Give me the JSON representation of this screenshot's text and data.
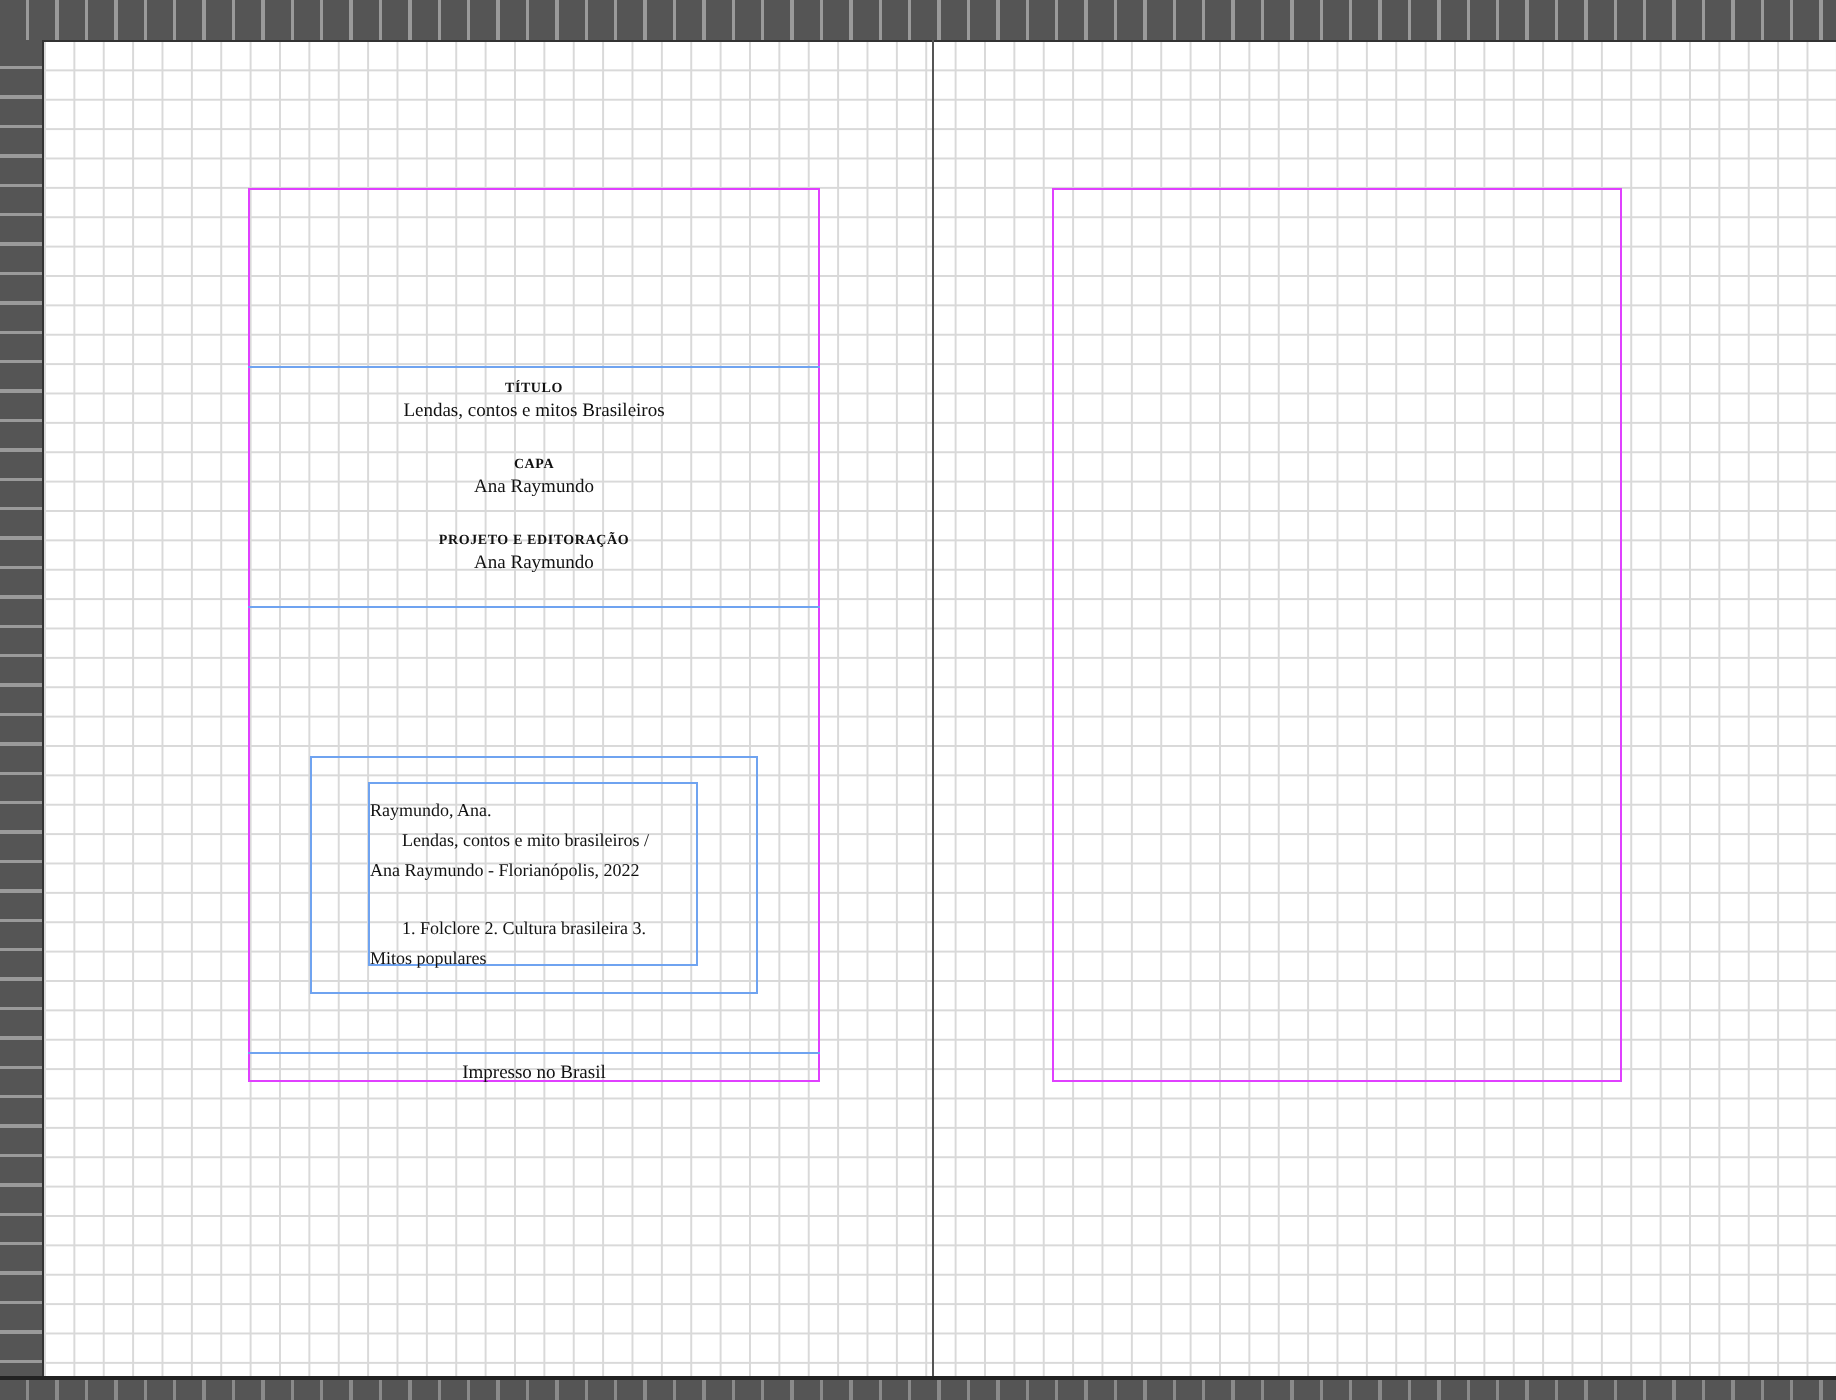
{
  "left_page": {
    "credits": [
      {
        "label": "TÍTULO",
        "value": "Lendas, contos e mitos Brasileiros"
      },
      {
        "label": "CAPA",
        "value": "Ana Raymundo"
      },
      {
        "label": "PROJETO E EDITORAÇÃO",
        "value": "Ana Raymundo"
      }
    ],
    "catalog_card": {
      "lines": [
        {
          "text": "Raymundo, Ana.",
          "indent": false
        },
        {
          "text": "Lendas, contos e mito brasileiros /",
          "indent": true
        },
        {
          "text": "Ana Raymundo - Florianópolis, 2022",
          "indent": false
        },
        {
          "text": "1. Folclore 2. Cultura brasileira 3.",
          "indent": true,
          "gap_before": true
        },
        {
          "text": "Mitos populares",
          "indent": false
        }
      ]
    },
    "imprint": "Impresso no Brasil"
  },
  "right_page": {
    "empty": true
  }
}
